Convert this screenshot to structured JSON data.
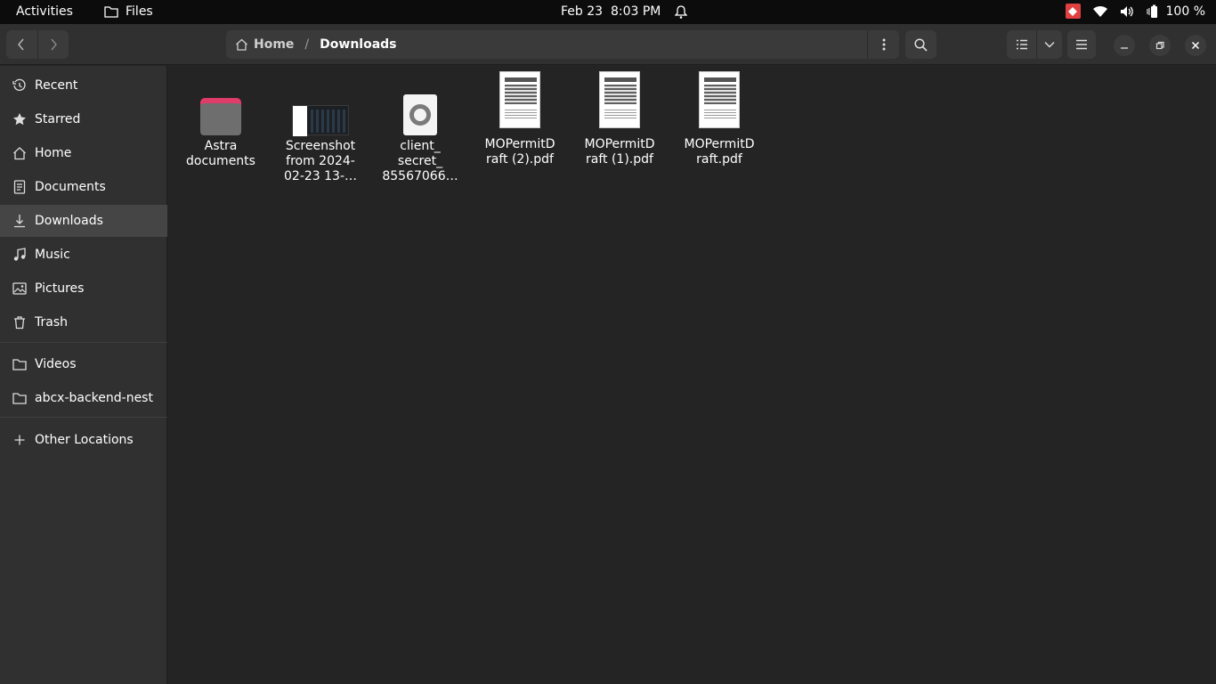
{
  "topbar": {
    "activities": "Activities",
    "app_name": "Files",
    "date": "Feb 23",
    "time": "8:03 PM",
    "battery": "100 %"
  },
  "header": {
    "path": {
      "home": "Home",
      "current": "Downloads"
    }
  },
  "sidebar": {
    "items": [
      {
        "label": "Recent",
        "icon": "clock-icon"
      },
      {
        "label": "Starred",
        "icon": "star-icon"
      },
      {
        "label": "Home",
        "icon": "home-icon"
      },
      {
        "label": "Documents",
        "icon": "document-icon"
      },
      {
        "label": "Downloads",
        "icon": "download-icon",
        "active": true
      },
      {
        "label": "Music",
        "icon": "music-icon"
      },
      {
        "label": "Pictures",
        "icon": "picture-icon"
      },
      {
        "label": "Trash",
        "icon": "trash-icon"
      },
      {
        "label": "Videos",
        "icon": "folder-icon"
      },
      {
        "label": "abcx-backend-nest",
        "icon": "folder-icon"
      },
      {
        "label": "Other Locations",
        "icon": "plus-icon"
      }
    ]
  },
  "files": [
    {
      "name": "Astra documents",
      "kind": "folder"
    },
    {
      "name": "Screenshot from 2024-02-23 13-…",
      "kind": "image"
    },
    {
      "name": "client_ secret_ 85567066…",
      "kind": "json"
    },
    {
      "name": "MOPermitD raft (2).pdf",
      "kind": "pdf"
    },
    {
      "name": "MOPermitD raft (1).pdf",
      "kind": "pdf"
    },
    {
      "name": "MOPermitD raft.pdf",
      "kind": "pdf"
    }
  ],
  "colors": {
    "window_bg": "#242424",
    "sidebar_bg": "#303030",
    "topbar_bg": "#0c0c0c",
    "folder_tab": "#e03c6a",
    "folder_body": "#6e6e6e",
    "active_item": "#454545"
  }
}
